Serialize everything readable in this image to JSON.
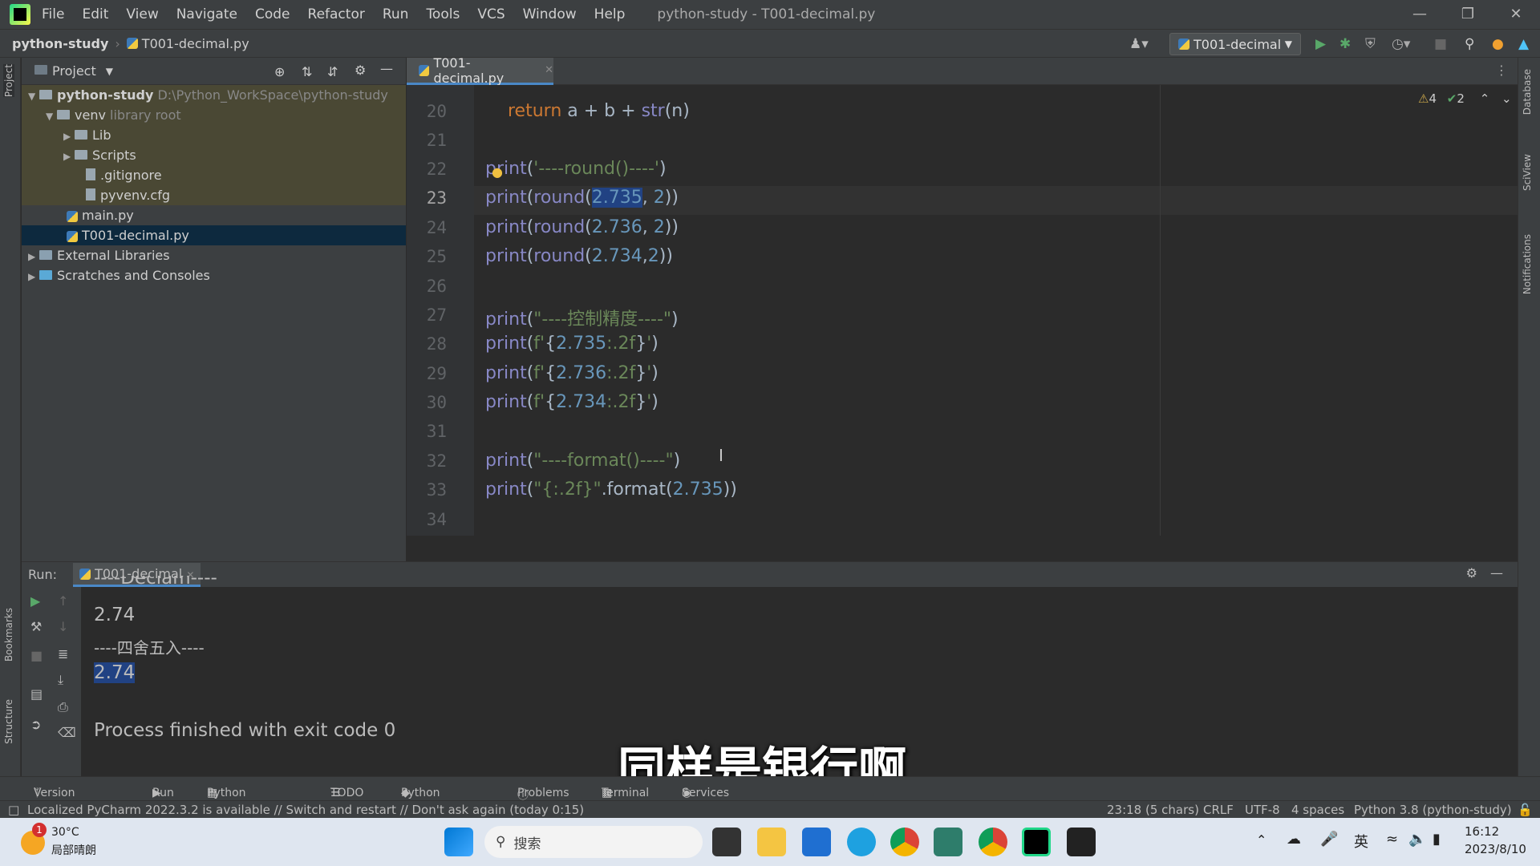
{
  "menu": [
    "File",
    "Edit",
    "View",
    "Navigate",
    "Code",
    "Refactor",
    "Run",
    "Tools",
    "VCS",
    "Window",
    "Help"
  ],
  "window_title": "python-study - T001-decimal.py",
  "breadcrumb": {
    "project": "python-study",
    "file": "T001-decimal.py"
  },
  "run_config": "T001-decimal",
  "project_panel": {
    "title": "Project",
    "root_name": "python-study",
    "root_path": "D:\\Python_WorkSpace\\python-study",
    "venv": "venv",
    "venv_hint": "library root",
    "lib": "Lib",
    "scripts": "Scripts",
    "gitignore": ".gitignore",
    "pyvenv": "pyvenv.cfg",
    "main": "main.py",
    "decimal": "T001-decimal.py",
    "ext_libs": "External Libraries",
    "scratches": "Scratches and Consoles"
  },
  "editor": {
    "tab": "T001-decimal.py",
    "inspections": {
      "warnings": "4",
      "ok": "2"
    },
    "line_numbers": [
      "20",
      "21",
      "22",
      "23",
      "24",
      "25",
      "26",
      "27",
      "28",
      "29",
      "30",
      "31",
      "32",
      "33",
      "34"
    ]
  },
  "run_panel": {
    "label": "Run:",
    "tab": "T001-decimal",
    "output": {
      "partial": "----Declam----",
      "v1": "2.74",
      "header2": "----四舍五入----",
      "v2": "2.74",
      "finished": "Process finished with exit code 0"
    }
  },
  "bottom_tools": [
    "Version Control",
    "Run",
    "Python Packages",
    "TODO",
    "Python Console",
    "Problems",
    "Terminal",
    "Services"
  ],
  "status": {
    "message": "Localized PyCharm 2022.3.2 is available // Switch and restart // Don't ask again (today 0:15)",
    "position": "23:18 (5 chars)",
    "line_sep": "CRLF",
    "encoding": "UTF-8",
    "indent": "4 spaces",
    "interpreter": "Python 3.8 (python-study)"
  },
  "subtitle": "同样是银行啊",
  "side_labels": {
    "project": "Project",
    "bookmarks": "Bookmarks",
    "structure": "Structure",
    "database": "Database",
    "sciview": "SciView",
    "notifications": "Notifications"
  },
  "taskbar": {
    "temp": "30°C",
    "weather": "局部晴朗",
    "badge": "1",
    "search": "搜索",
    "ime": "英",
    "time": "16:12",
    "date": "2023/8/10"
  }
}
